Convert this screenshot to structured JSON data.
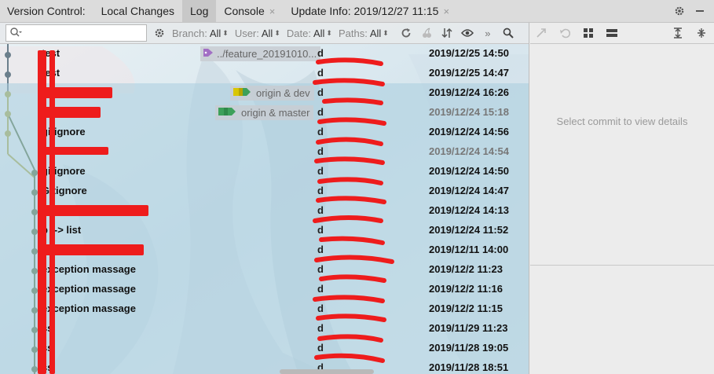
{
  "tabbar": {
    "label": "Version Control:",
    "tabs": [
      {
        "label": "Local Changes",
        "active": false,
        "closable": false
      },
      {
        "label": "Log",
        "active": true,
        "closable": false
      },
      {
        "label": "Console",
        "active": false,
        "closable": true
      },
      {
        "label": "Update Info: 2019/12/27 11:15",
        "active": false,
        "closable": true
      }
    ],
    "close_glyph": "×",
    "icons": [
      "gear-icon",
      "minimize-icon"
    ]
  },
  "toolbar": {
    "search_placeholder": "",
    "filters": [
      {
        "name": "Branch:",
        "value": "All"
      },
      {
        "name": "User:",
        "value": "All"
      },
      {
        "name": "Date:",
        "value": "All"
      },
      {
        "name": "Paths:",
        "value": "All"
      }
    ],
    "icons": [
      "refresh-icon",
      "cherry-pick-icon",
      "sort-icon",
      "eye-icon",
      "more-icon",
      "search-icon"
    ],
    "more_label": "»"
  },
  "colors": {
    "accent_green": "#55734a",
    "redaction": "#ee1c1c",
    "tag_purple": "#a26fc4",
    "branch_yellow": "#d9c600",
    "branch_green": "#3da05a"
  },
  "commits": [
    {
      "subject": "test",
      "date": "2019/12/25 14:50",
      "author": "d",
      "ref": "../feature_20191010...",
      "ref_icon": "tag-icon",
      "dim": false,
      "selected": false
    },
    {
      "subject": "test",
      "date": "2019/12/25 14:47",
      "author": "d",
      "ref": "",
      "dim": false,
      "selected": false
    },
    {
      "subject": "",
      "date": "2019/12/24 16:26",
      "author": "d",
      "ref": "origin & dev",
      "ref_icon": "branch-tag-yellow-icon",
      "dim": false,
      "selected": true
    },
    {
      "subject": "",
      "date": "2019/12/24 15:18",
      "author": "d",
      "ref": "origin & master",
      "ref_icon": "branch-tag-green-icon",
      "dim": true,
      "selected": true
    },
    {
      "subject": "gitignore",
      "date": "2019/12/24 14:56",
      "author": "d",
      "ref": "",
      "dim": false,
      "selected": true
    },
    {
      "subject": "",
      "date": "2019/12/24 14:54",
      "author": "d",
      "ref": "",
      "dim": true,
      "selected": true
    },
    {
      "subject": "gitignore",
      "date": "2019/12/24 14:50",
      "author": "d",
      "ref": "",
      "dim": false,
      "selected": true
    },
    {
      "subject": "Gitignore",
      "date": "2019/12/24 14:47",
      "author": "d",
      "ref": "",
      "dim": false,
      "selected": true
    },
    {
      "subject": "",
      "date": "2019/12/24 14:13",
      "author": "d",
      "ref": "",
      "dim": false,
      "selected": true
    },
    {
      "subject": "p --> list",
      "date": "2019/12/24 11:52",
      "author": "d",
      "ref": "",
      "dim": false,
      "selected": true
    },
    {
      "subject": "",
      "date": "2019/12/11 14:00",
      "author": "d",
      "ref": "",
      "dim": false,
      "selected": true
    },
    {
      "subject": "exception massage",
      "date": "2019/12/2 11:23",
      "author": "d",
      "ref": "",
      "dim": false,
      "selected": true
    },
    {
      "subject": "exception massage",
      "date": "2019/12/2 11:16",
      "author": "d",
      "ref": "",
      "dim": false,
      "selected": true
    },
    {
      "subject": "exception massage",
      "date": "2019/12/2 11:15",
      "author": "d",
      "ref": "",
      "dim": false,
      "selected": true
    },
    {
      "subject": "ss",
      "date": "2019/11/29 11:23",
      "author": "d",
      "ref": "",
      "dim": false,
      "selected": true
    },
    {
      "subject": "ss",
      "date": "2019/11/28 19:05",
      "author": "d",
      "ref": "",
      "dim": false,
      "selected": true
    },
    {
      "subject": "ss",
      "date": "2019/11/28 18:51",
      "author": "d",
      "ref": "",
      "dim": false,
      "selected": true
    }
  ],
  "details": {
    "empty_message": "Select commit to view details",
    "icons": [
      "cherry-pick-icon",
      "revert-icon",
      "grid-icon",
      "layout-icon",
      "expand-all-icon",
      "collapse-all-icon"
    ]
  }
}
